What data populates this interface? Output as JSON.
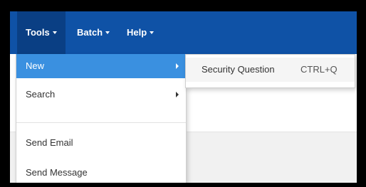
{
  "navbar": {
    "menus": [
      {
        "label": "Tools"
      },
      {
        "label": "Batch"
      },
      {
        "label": "Help"
      }
    ]
  },
  "tools_menu": {
    "items": [
      {
        "label": "New",
        "has_submenu": true,
        "active": true
      },
      {
        "label": "Search",
        "has_submenu": true
      },
      {
        "label": "Send Email"
      },
      {
        "label": "Send Message"
      }
    ]
  },
  "new_submenu": {
    "items": [
      {
        "label": "Security Question",
        "shortcut": "CTRL+Q"
      }
    ]
  },
  "colors": {
    "navbar": "#0f52a6",
    "navbar_active": "#0a3f84",
    "menu_active": "#3a90e0"
  }
}
